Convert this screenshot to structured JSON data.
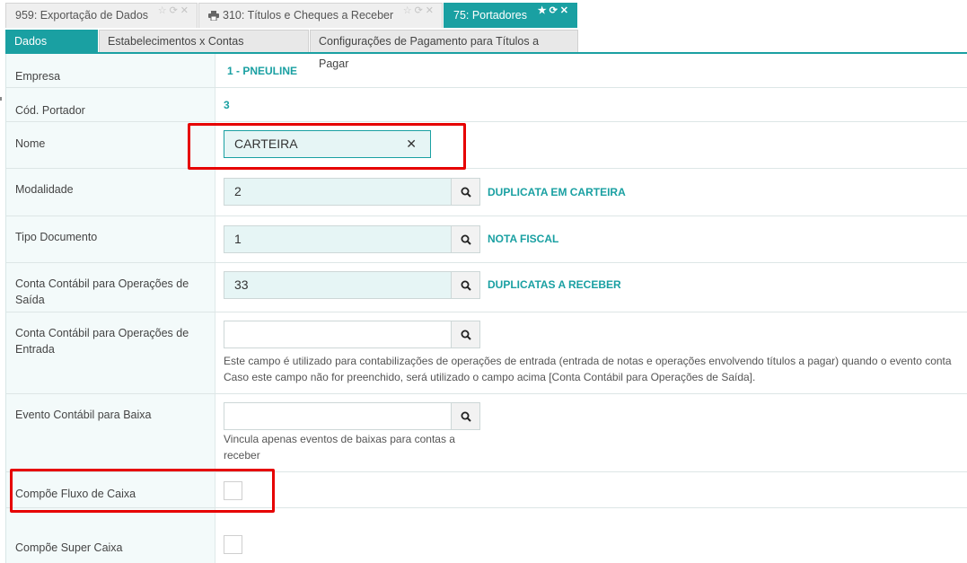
{
  "window_tabs": [
    {
      "label": "959: Exportação de Dados"
    },
    {
      "label": "310: Títulos e Cheques a Receber"
    },
    {
      "label": "75: Portadores"
    }
  ],
  "inner_tabs": [
    {
      "label": "Dados Básicos"
    },
    {
      "label": "Estabelecimentos x Contas Financeiras"
    },
    {
      "label": "Configurações de Pagamento para Títulos a Pagar"
    }
  ],
  "form": {
    "empresa": {
      "label": "Empresa",
      "value": "1 - PNEULINE"
    },
    "cod_portador": {
      "label": "Cód. Portador",
      "value": "3"
    },
    "nome": {
      "label": "Nome",
      "value": "CARTEIRA",
      "clear_glyph": "✕"
    },
    "modalidade": {
      "label": "Modalidade",
      "value": "2",
      "description": "DUPLICATA EM CARTEIRA"
    },
    "tipo_documento": {
      "label": "Tipo Documento",
      "value": "1",
      "description": "NOTA FISCAL"
    },
    "conta_saida": {
      "label_line1": "Conta Contábil para Operações de",
      "label_line2": "Saída",
      "value": "33",
      "description": "DUPLICATAS A RECEBER"
    },
    "conta_entrada": {
      "label_line1": "Conta Contábil para Operações de",
      "label_line2": "Entrada",
      "value": "",
      "help_line1": "Este campo é utilizado para contabilizações de operações de entrada (entrada de notas e operações envolvendo títulos a pagar) quando o evento conta",
      "help_line2": "Caso este campo não for preenchido, será utilizado o campo acima [Conta Contábil para Operações de Saída]."
    },
    "evento_baixa": {
      "label": "Evento Contábil para Baixa",
      "value": "",
      "help_line1": "Vincula apenas eventos de baixas para contas a",
      "help_line2": "receber"
    },
    "compoe_fluxo": {
      "label": "Compõe Fluxo de Caixa",
      "checked": false
    },
    "compoe_super": {
      "label": "Compõe Super Caixa",
      "checked": false
    }
  },
  "colors": {
    "accent": "#1aa0a2",
    "highlight": "#e60000",
    "input_bg": "#e6f5f5"
  }
}
